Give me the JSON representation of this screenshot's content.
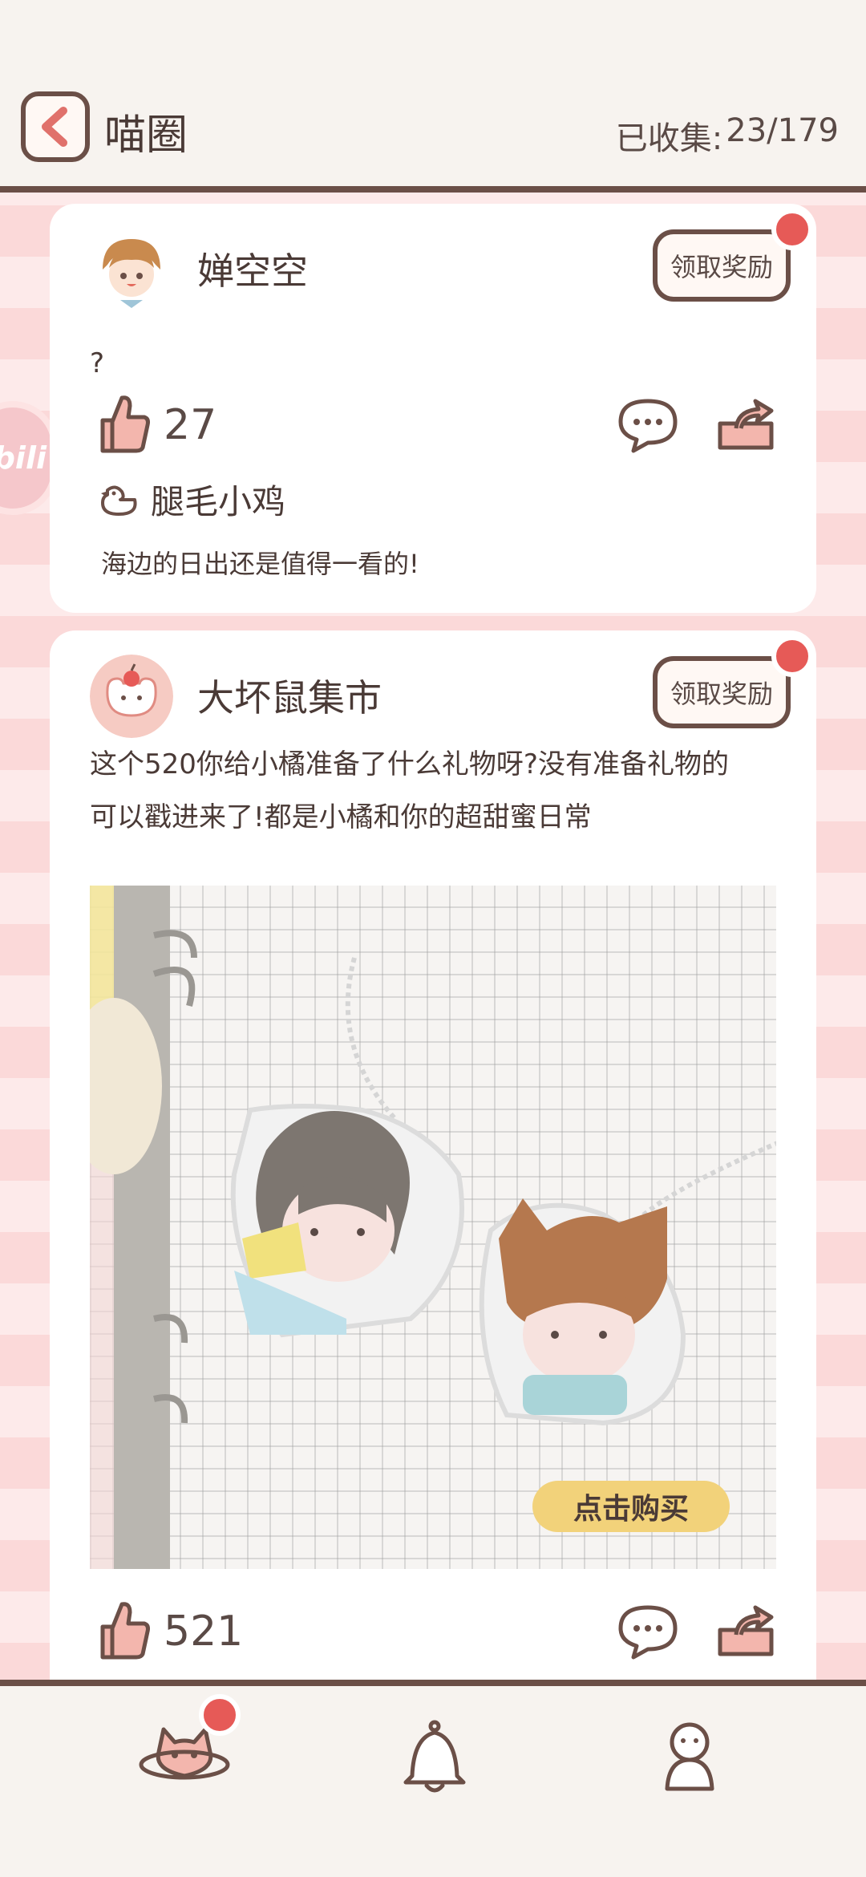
{
  "header": {
    "title": "喵圈",
    "collected_label": "已收集:",
    "collected_value": "23/179"
  },
  "side_bubble": {
    "text": "bili"
  },
  "posts": [
    {
      "username": "婵空空",
      "reward_label": "领取奖励",
      "text": "?",
      "likes": "27",
      "comment": {
        "author": "腿毛小鸡",
        "text": "海边的日出还是值得一看的!"
      }
    },
    {
      "username": "大坏鼠集市",
      "reward_label": "领取奖励",
      "text_line1": "这个520你给小橘准备了什么礼物呀?没有准备礼物的",
      "text_line2": "可以戳进来了!都是小橘和你的超甜蜜日常",
      "buy_label": "点击购买",
      "likes": "521"
    }
  ],
  "colors": {
    "accent_red": "#e65a57",
    "outline_brown": "#6b4f47",
    "background_pink": "#fbd9d9"
  },
  "icons": {
    "back": "chevron-left-icon",
    "like": "thumbs-up-icon",
    "comment": "speech-bubble-icon",
    "share": "share-icon",
    "chick": "chick-icon",
    "nav_home": "cat-planet-icon",
    "nav_notifications": "bell-icon",
    "nav_profile": "person-icon"
  }
}
